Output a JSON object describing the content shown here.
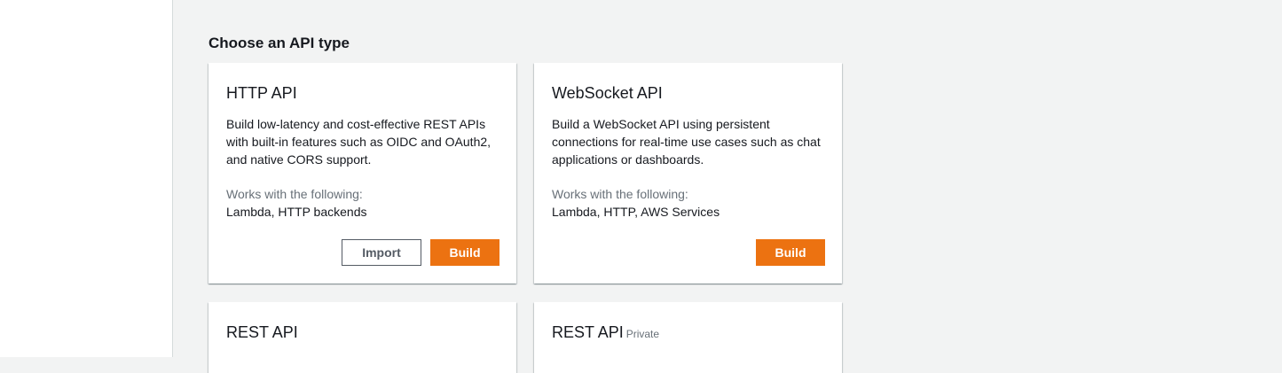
{
  "heading": "Choose an API type",
  "cards": [
    {
      "title": "HTTP API",
      "description": "Build low-latency and cost-effective REST APIs with built-in features such as OIDC and OAuth2, and native CORS support.",
      "works_label": "Works with the following:",
      "works_value": "Lambda, HTTP backends",
      "import_label": "Import",
      "build_label": "Build"
    },
    {
      "title": "WebSocket API",
      "description": "Build a WebSocket API using persistent connections for real-time use cases such as chat applications or dashboards.",
      "works_label": "Works with the following:",
      "works_value": "Lambda, HTTP, AWS Services",
      "build_label": "Build"
    },
    {
      "title": "REST API"
    },
    {
      "title": "REST API",
      "subtitle": "Private"
    }
  ]
}
